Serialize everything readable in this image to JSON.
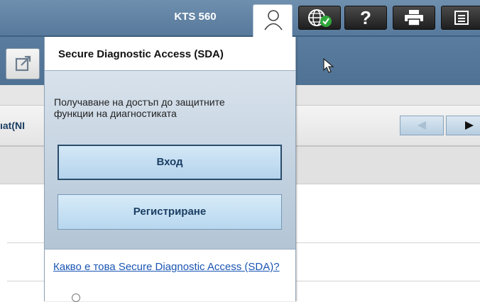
{
  "header": {
    "device_label": "KTS 560",
    "icons": {
      "user": "user-icon",
      "globe": "globe-check-icon",
      "help": "question-icon",
      "print": "printer-icon",
      "more": "list-icon"
    }
  },
  "toolbar": {
    "open_icon": "external-link-icon"
  },
  "tabs": {
    "label": "ıat(NI",
    "prev_icon": "triangle-left-icon",
    "next_icon": "triangle-right-icon"
  },
  "sda_popup": {
    "title": "Secure Diagnostic Access (SDA)",
    "description": "Получаване на достъп до защитните функции на диагностиката",
    "login_label": "Вход",
    "register_label": "Регистриране",
    "info_link": "Какво е това Secure Diagnostic Access (SDA)?"
  },
  "colors": {
    "header": "#5f80a2",
    "popup_body": "#c4d3e1",
    "button_text": "#1b3e63",
    "link": "#1a55b3"
  }
}
